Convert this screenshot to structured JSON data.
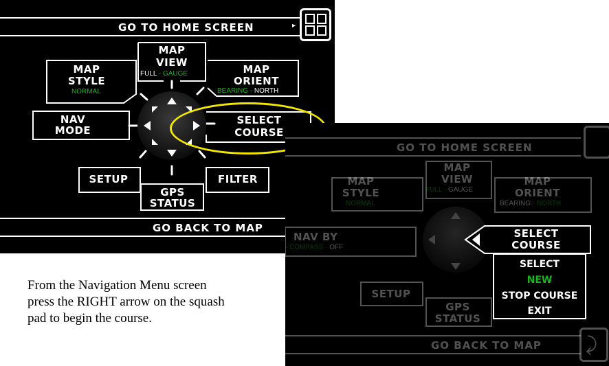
{
  "screen1": {
    "home_label": "GO TO HOME SCREEN",
    "back_label": "GO BACK TO MAP",
    "map_view": {
      "title1": "MAP",
      "title2": "VIEW",
      "opt_a": "FULL",
      "sep": " - ",
      "opt_b": "GAUGE"
    },
    "map_style": {
      "title1": "MAP",
      "title2": "STYLE",
      "value": "NORMAL"
    },
    "map_orient": {
      "title1": "MAP",
      "title2": "ORIENT",
      "opt_a": "BEARING",
      "sep": " - ",
      "opt_b": "NORTH"
    },
    "nav_mode": {
      "title1": "NAV",
      "title2": "MODE"
    },
    "select_course": {
      "title1": "SELECT",
      "title2": "COURSE"
    },
    "setup": "SETUP",
    "gps_status": {
      "title1": "GPS",
      "title2": "STATUS"
    },
    "filter": "FILTER"
  },
  "screen2": {
    "home_label": "GO TO HOME SCREEN",
    "back_label": "GO BACK TO MAP",
    "map_view": {
      "title1": "MAP",
      "title2": "VIEW",
      "opt_a": "FULL",
      "sep": " - ",
      "opt_b": "GAUGE"
    },
    "map_style": {
      "title1": "MAP",
      "title2": "STYLE",
      "value": "NORMAL"
    },
    "map_orient": {
      "title1": "MAP",
      "title2": "ORIENT",
      "opt_a": "BEARING",
      "sep": " - ",
      "opt_b": "NORTH"
    },
    "nav_by": {
      "title": "NAV BY",
      "opt_a": "COMPASS",
      "sep": " - ",
      "opt_b": "OFF"
    },
    "select_course": {
      "title1": "SELECT",
      "title2": "COURSE"
    },
    "setup": "SETUP",
    "gps_status": {
      "title1": "GPS",
      "title2": "STATUS"
    },
    "submenu": [
      "SELECT",
      "NEW",
      "STOP COURSE",
      "EXIT"
    ]
  },
  "caption": "From the Navigation Menu screen press the RIGHT arrow on the squash pad to begin the course.",
  "colors": {
    "highlight": "#f2e700",
    "selected_green": "#19b31c",
    "background": "#000000"
  }
}
